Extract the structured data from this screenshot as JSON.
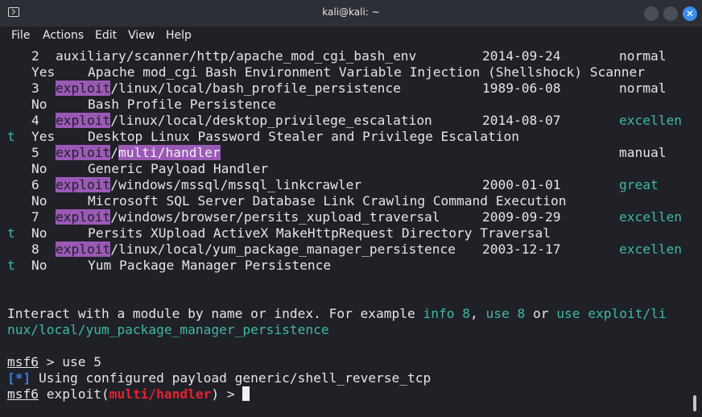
{
  "window": {
    "title": "kali@kali: ~",
    "minimize_label": "",
    "maximize_label": "",
    "close_label": "✕"
  },
  "menu": [
    "File",
    "Actions",
    "Edit",
    "View",
    "Help"
  ],
  "modules": [
    {
      "num": "2",
      "prefix": "",
      "path": "auxiliary/scanner/http/apache_mod_cgi_bash_env",
      "date": "2014-09-24",
      "rank": "normal",
      "rank_wrap": "",
      "check": "Yes",
      "desc": "Apache mod_cgi Bash Environment Variable Injection (Shellshock) Scanner"
    },
    {
      "num": "3",
      "prefix": "exploit",
      "path": "/linux/local/bash_profile_persistence",
      "date": "1989-06-08",
      "rank": "normal",
      "rank_wrap": "",
      "check": "No",
      "desc": "Bash Profile Persistence"
    },
    {
      "num": "4",
      "prefix": "exploit",
      "path": "/linux/local/desktop_privilege_escalation",
      "date": "2014-08-07",
      "rank": "excellen",
      "rank_wrap": "t",
      "check": "Yes",
      "desc": "Desktop Linux Password Stealer and Privilege Escalation"
    },
    {
      "num": "5",
      "prefix": "exploit",
      "path_sep": "/",
      "path_hl": "multi/handler",
      "date": "",
      "rank": "manual",
      "rank_wrap": "",
      "check": "No",
      "desc": "Generic Payload Handler"
    },
    {
      "num": "6",
      "prefix": "exploit",
      "path": "/windows/mssql/mssql_linkcrawler",
      "date": "2000-01-01",
      "rank": "great",
      "rank_wrap": "",
      "check": "No",
      "desc": "Microsoft SQL Server Database Link Crawling Command Execution"
    },
    {
      "num": "7",
      "prefix": "exploit",
      "path": "/windows/browser/persits_xupload_traversal",
      "date": "2009-09-29",
      "rank": "excellen",
      "rank_wrap": "t",
      "check": "No",
      "desc": "Persits XUpload ActiveX MakeHttpRequest Directory Traversal"
    },
    {
      "num": "8",
      "prefix": "exploit",
      "path": "/linux/local/yum_package_manager_persistence",
      "date": "2003-12-17",
      "rank": "excellen",
      "rank_wrap": "t",
      "check": "No",
      "desc": "Yum Package Manager Persistence"
    }
  ],
  "interact": {
    "text1": "Interact with a module by name or index. For example ",
    "info": "info 8",
    "sep1": ", ",
    "use": "use 8",
    "sep2": " or ",
    "use_path1": "use exploit/li",
    "use_path2": "nux/local/yum_package_manager_persistence"
  },
  "session": {
    "prompt": "msf6",
    "cmd1": " > use 5",
    "star_open": "[",
    "star": "*",
    "star_close": "]",
    "info_msg": " Using configured payload generic/shell_reverse_tcp",
    "exploit_open": " exploit(",
    "module": "multi/handler",
    "exploit_close": ") > "
  },
  "colors": {
    "background": "#1f2127",
    "highlight": "#9b59b6",
    "teal": "#3fb8a4",
    "red": "#e8202e",
    "blue": "#3c7ee0"
  }
}
